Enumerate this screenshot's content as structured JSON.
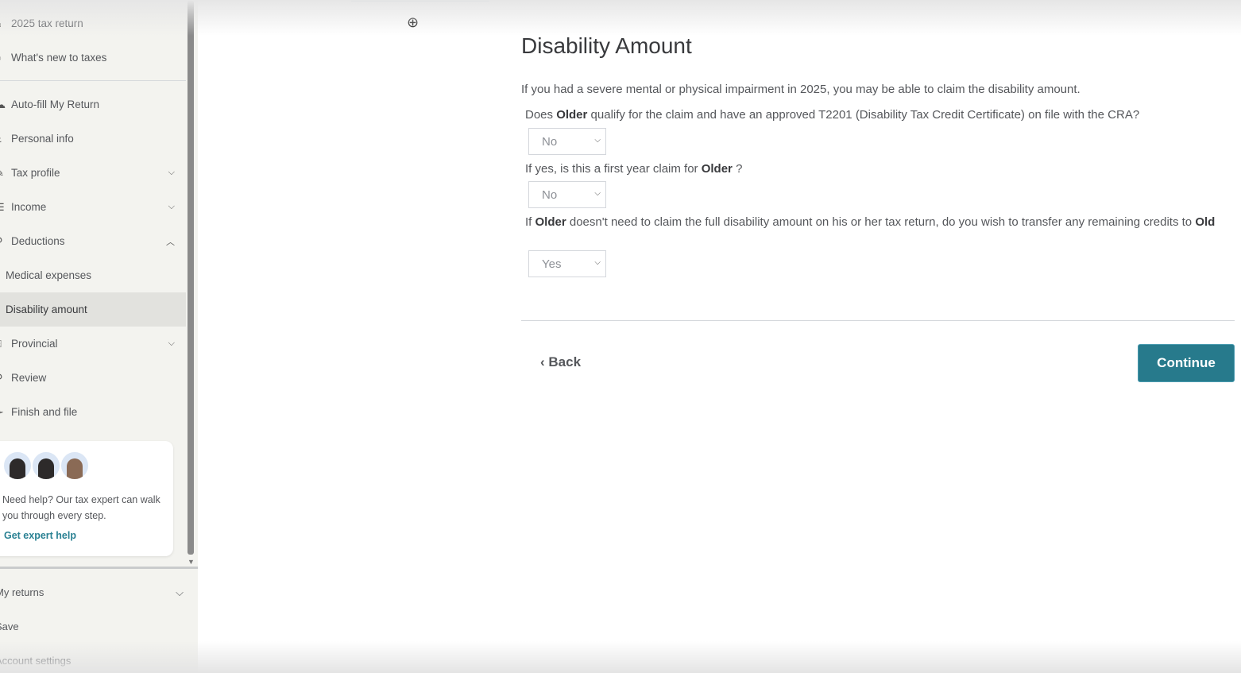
{
  "sidebar": {
    "items": [
      {
        "label": "2025 tax return",
        "icon": "home-icon"
      },
      {
        "label": "What's new to taxes",
        "icon": "bell-icon"
      },
      {
        "label": "Auto-fill My Return",
        "icon": "cloud-icon"
      },
      {
        "label": "Personal info",
        "icon": "person-icon"
      },
      {
        "label": "Tax profile",
        "icon": "edit-icon",
        "chevron": "down"
      },
      {
        "label": "Income",
        "icon": "income-icon",
        "chevron": "down"
      },
      {
        "label": "Deductions",
        "icon": "deductions-icon",
        "chevron": "up"
      },
      {
        "label": "Medical expenses"
      },
      {
        "label": "Disability amount",
        "active": true
      },
      {
        "label": "Provincial",
        "icon": "building-icon",
        "chevron": "down"
      },
      {
        "label": "Review",
        "icon": "review-icon"
      },
      {
        "label": "Finish and file",
        "icon": "send-icon"
      }
    ],
    "help_card": {
      "text": "Need help? Our tax expert can walk you through every step.",
      "link": "Get expert help"
    },
    "bottom": [
      {
        "label": "My returns"
      },
      {
        "label": "Save"
      },
      {
        "label": "Account settings"
      }
    ]
  },
  "main": {
    "title": "Disability Amount",
    "intro": "If you had a severe mental or physical impairment in 2025, you may be able to claim the disability amount.",
    "questions": [
      {
        "pre": "Does ",
        "bold": "Older",
        "post": " qualify for the claim and have an approved T2201 (Disability Tax Credit Certificate) on file with the CRA?",
        "value": "No"
      },
      {
        "pre": "If yes, is this a first year claim for ",
        "bold": "Older",
        "post": " ?",
        "value": "No"
      },
      {
        "pre": "If ",
        "bold": "Older",
        "post": " doesn't need to claim the full disability amount on his or her tax return, do you wish to transfer any remaining credits to ",
        "bold2": "Old",
        "value": "Yes"
      }
    ],
    "back": "Back",
    "continue": "Continue"
  },
  "colors": {
    "accent": "#277a8c",
    "link": "#2a8193"
  }
}
